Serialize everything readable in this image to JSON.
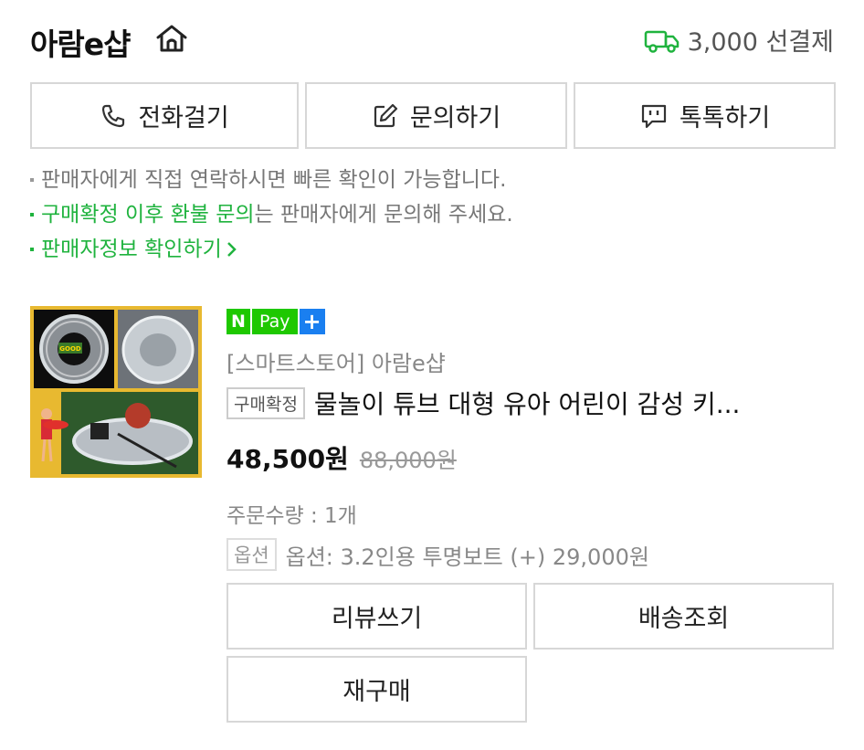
{
  "store": {
    "name": "아람e샵",
    "home_icon": "home-icon",
    "shipping_icon": "truck-icon",
    "shipping_text": "3,000 선결제",
    "accent_color": "#1fb33e"
  },
  "contact": {
    "call_label": "전화걸기",
    "inquire_label": "문의하기",
    "talk_label": "톡톡하기",
    "call_icon": "phone-icon",
    "inquire_icon": "edit-icon",
    "talk_icon": "chat-icon"
  },
  "notes": {
    "line1": "판매자에게 직접 연락하시면 빠른 확인이 가능합니다.",
    "line2_highlight": "구매확정 이후 환불 문의",
    "line2_rest": "는 판매자에게 문의해 주세요.",
    "line3_link": "판매자정보 확인하기"
  },
  "product": {
    "npay_n": "N",
    "npay_pay": "Pay",
    "npay_plus": "+",
    "store_label": "[스마트스토어] 아람e샵",
    "confirm_badge": "구매확정",
    "title": "물놀이 튜브 대형 유아 어린이 감성 키...",
    "price": "48,500원",
    "original_price": "88,000원",
    "quantity": "주문수량 : 1개",
    "option_badge": "옵션",
    "option_text": "옵션: 3.2인용 투명보트 (+) 29,000원",
    "thumb_badge": "GOOD"
  },
  "actions": {
    "review_label": "리뷰쓰기",
    "track_label": "배송조회",
    "rebuy_label": "재구매"
  }
}
